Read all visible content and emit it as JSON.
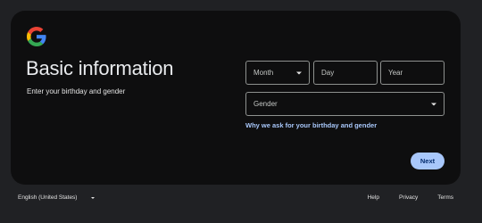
{
  "card": {
    "title": "Basic information",
    "subtitle": "Enter your birthday and gender"
  },
  "form": {
    "month": "Month",
    "day": "Day",
    "year": "Year",
    "gender": "Gender",
    "why_link": "Why we ask for your birthday and gender",
    "next": "Next"
  },
  "footer": {
    "language": "English (United States)",
    "links": [
      "Help",
      "Privacy",
      "Terms"
    ]
  },
  "colors": {
    "background": "#202124",
    "card": "#0e0e0f",
    "accent": "#a8c7fa"
  },
  "icons": {
    "logo": "google-logo-icon",
    "caret": "chevron-down-icon"
  }
}
